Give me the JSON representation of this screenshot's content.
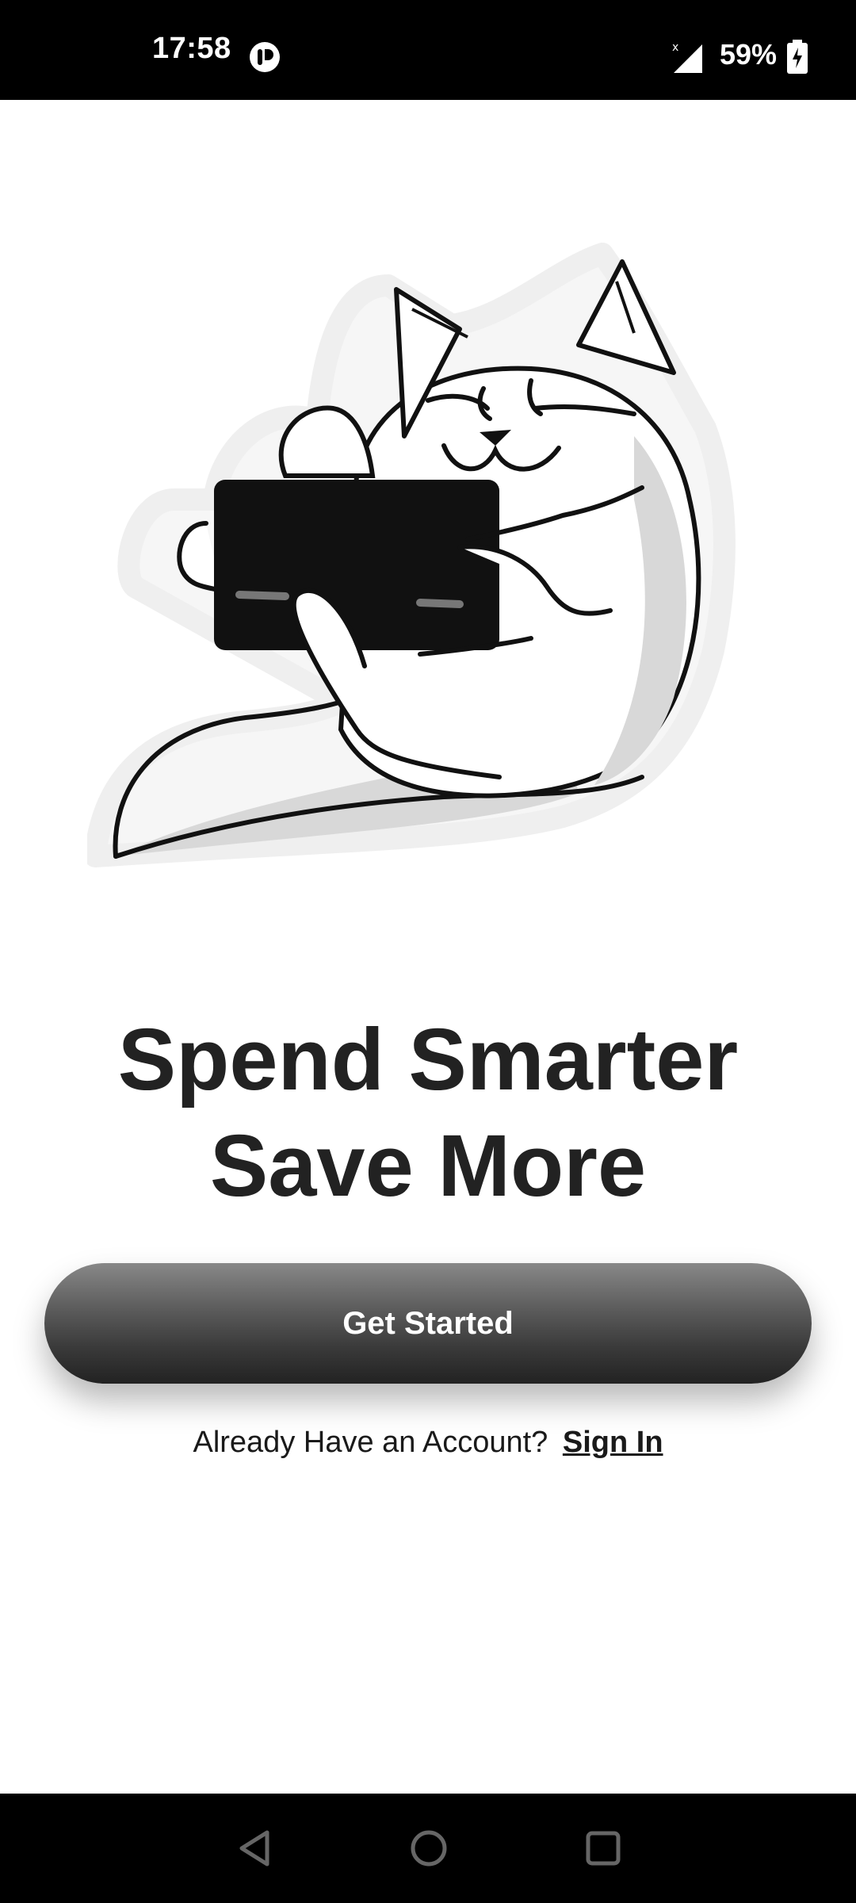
{
  "status_bar": {
    "time": "17:58",
    "app_icon": "notification-app-icon",
    "signal_icon": "signal-no-data-icon",
    "battery_percent": "59%",
    "battery_icon": "battery-charging-icon"
  },
  "illustration": {
    "icon": "cat-holding-card-illustration"
  },
  "headline": {
    "line1": "Spend Smarter",
    "line2": "Save More"
  },
  "cta": {
    "label": "Get Started"
  },
  "signin": {
    "prompt": "Already Have an Account?",
    "link_label": "Sign In"
  },
  "nav_bar": {
    "back_icon": "back-triangle-icon",
    "home_icon": "home-circle-icon",
    "recents_icon": "recents-square-icon"
  },
  "colors": {
    "text_primary": "#222222",
    "button_top": "#888888",
    "button_bottom": "#222222",
    "system_bars": "#000000"
  }
}
